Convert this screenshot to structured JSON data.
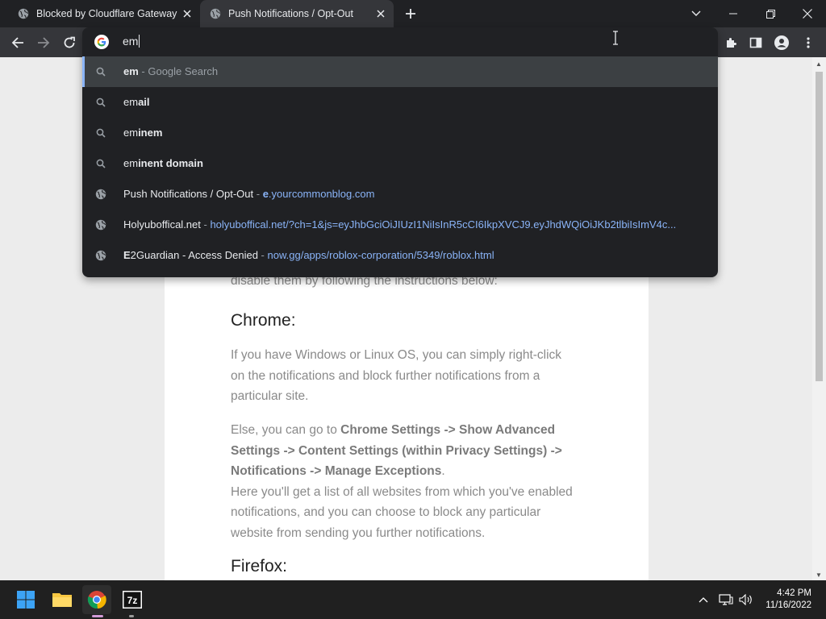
{
  "tabs": [
    {
      "title": "Blocked by Cloudflare Gateway"
    },
    {
      "title": "Push Notifications / Opt-Out"
    }
  ],
  "omnibox": {
    "typed": "em",
    "suggestions": [
      {
        "type": "search",
        "bold": "em",
        "rest": "",
        "hint": " - Google Search"
      },
      {
        "type": "search",
        "plain": "em",
        "bold": "ail"
      },
      {
        "type": "search",
        "plain": "em",
        "bold": "inem"
      },
      {
        "type": "search",
        "plain": "em",
        "bold": "inent domain"
      },
      {
        "type": "history",
        "title": "Push Notifications / Opt-Out",
        "sep": " - ",
        "url_bold": "e",
        "url_rest": ".yourcommonblog.com"
      },
      {
        "type": "history",
        "title": "Holyuboffical.net",
        "sep": " - ",
        "url": "holyuboffical.net/?ch=1&js=eyJhbGciOiJIUzI1NiIsInR5cCI6IkpXVCJ9.eyJhdWQiOiJKb2tlbiIsImV4c..."
      },
      {
        "type": "history",
        "title_bold": "E",
        "title_rest": "2Guardian - Access Denied",
        "sep": " - ",
        "url": "now.gg/apps/roblox-corporation/5349/roblox.html"
      }
    ]
  },
  "article": {
    "partial_line": "disable them by following the instructions below:",
    "heading_chrome": "Chrome:",
    "para1": "If you have Windows or Linux OS, you can simply right-click on the notifications and block further notifications from a particular site.",
    "para2_lead": "Else, you can go to ",
    "para2_bold": "Chrome Settings -> Show Advanced Settings -> Content Settings (within Privacy Settings) -> Notifications -> Manage Exceptions",
    "para2_end": ".",
    "para3": "Here you'll get a list of all websites from which you've enabled notifications, and you can choose to block any particular website from sending you further notifications.",
    "heading_firefox": "Firefox:"
  },
  "taskbar": {
    "time": "4:42 PM",
    "date": "11/16/2022"
  },
  "colors": {
    "chrome_dark": "#202124",
    "tab_active": "#35363a",
    "link_blue": "#8ab4f8",
    "taskbar": "#202020"
  },
  "icons": [
    "globe-icon",
    "close-icon",
    "plus-icon",
    "chevron-down-icon",
    "minimize-icon",
    "restore-icon",
    "window-close-icon",
    "back-icon",
    "forward-icon",
    "reload-icon",
    "google-icon",
    "search-icon",
    "extensions-icon",
    "side-panel-icon",
    "profile-icon",
    "more-icon",
    "windows-start-icon",
    "file-explorer-icon",
    "chrome-icon",
    "7zip-icon",
    "tray-chevron-icon",
    "network-icon",
    "volume-icon"
  ]
}
